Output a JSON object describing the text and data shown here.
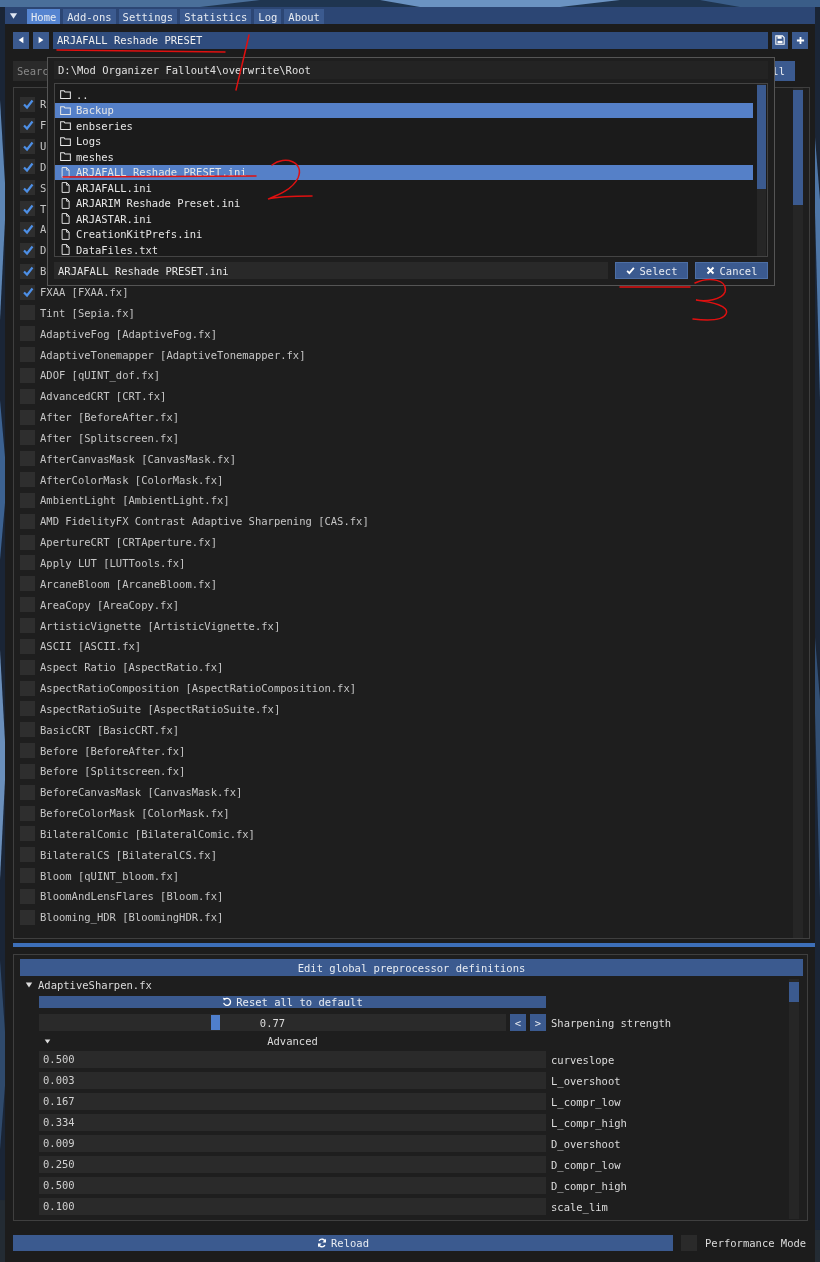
{
  "menu": {
    "tabs": [
      {
        "label": "Home",
        "selected": true
      },
      {
        "label": "Add-ons",
        "selected": false
      },
      {
        "label": "Settings",
        "selected": false
      },
      {
        "label": "Statistics",
        "selected": false
      },
      {
        "label": "Log",
        "selected": false
      },
      {
        "label": "About",
        "selected": false
      }
    ]
  },
  "preset": {
    "value": "ARJAFALL Reshade PRESET"
  },
  "search": {
    "placeholder": "Searc",
    "button": "ll"
  },
  "effects": [
    {
      "label": "R",
      "checked": true
    },
    {
      "label": "F",
      "checked": true
    },
    {
      "label": "U",
      "checked": true
    },
    {
      "label": "D",
      "checked": true
    },
    {
      "label": "S",
      "checked": true
    },
    {
      "label": "T",
      "checked": true
    },
    {
      "label": "A",
      "checked": true
    },
    {
      "label": "D",
      "checked": true
    },
    {
      "label": "B",
      "checked": true
    },
    {
      "label": "FXAA [FXAA.fx]",
      "checked": true
    },
    {
      "label": "Tint [Sepia.fx]",
      "checked": false
    },
    {
      "label": "AdaptiveFog [AdaptiveFog.fx]",
      "checked": false
    },
    {
      "label": "AdaptiveTonemapper [AdaptiveTonemapper.fx]",
      "checked": false
    },
    {
      "label": "ADOF [qUINT_dof.fx]",
      "checked": false
    },
    {
      "label": "AdvancedCRT [CRT.fx]",
      "checked": false
    },
    {
      "label": "After [BeforeAfter.fx]",
      "checked": false
    },
    {
      "label": "After [Splitscreen.fx]",
      "checked": false
    },
    {
      "label": "AfterCanvasMask [CanvasMask.fx]",
      "checked": false
    },
    {
      "label": "AfterColorMask [ColorMask.fx]",
      "checked": false
    },
    {
      "label": "AmbientLight [AmbientLight.fx]",
      "checked": false
    },
    {
      "label": "AMD FidelityFX Contrast Adaptive Sharpening [CAS.fx]",
      "checked": false
    },
    {
      "label": "ApertureCRT [CRTAperture.fx]",
      "checked": false
    },
    {
      "label": "Apply LUT [LUTTools.fx]",
      "checked": false
    },
    {
      "label": "ArcaneBloom [ArcaneBloom.fx]",
      "checked": false
    },
    {
      "label": "AreaCopy [AreaCopy.fx]",
      "checked": false
    },
    {
      "label": "ArtisticVignette [ArtisticVignette.fx]",
      "checked": false
    },
    {
      "label": "ASCII [ASCII.fx]",
      "checked": false
    },
    {
      "label": "Aspect Ratio [AspectRatio.fx]",
      "checked": false
    },
    {
      "label": "AspectRatioComposition [AspectRatioComposition.fx]",
      "checked": false
    },
    {
      "label": "AspectRatioSuite [AspectRatioSuite.fx]",
      "checked": false
    },
    {
      "label": "BasicCRT [BasicCRT.fx]",
      "checked": false
    },
    {
      "label": "Before [BeforeAfter.fx]",
      "checked": false
    },
    {
      "label": "Before [Splitscreen.fx]",
      "checked": false
    },
    {
      "label": "BeforeCanvasMask [CanvasMask.fx]",
      "checked": false
    },
    {
      "label": "BeforeColorMask [ColorMask.fx]",
      "checked": false
    },
    {
      "label": "BilateralComic [BilateralComic.fx]",
      "checked": false
    },
    {
      "label": "BilateralCS [BilateralCS.fx]",
      "checked": false
    },
    {
      "label": "Bloom [qUINT_bloom.fx]",
      "checked": false
    },
    {
      "label": "BloomAndLensFlares [Bloom.fx]",
      "checked": false
    },
    {
      "label": "Blooming_HDR [BloomingHDR.fx]",
      "checked": false
    }
  ],
  "file_dialog": {
    "path": "D:\\Mod Organizer Fallout4\\overwrite\\Root",
    "entries": [
      {
        "kind": "folder",
        "name": "..",
        "selected": false
      },
      {
        "kind": "folder",
        "name": "Backup",
        "selected": true
      },
      {
        "kind": "folder",
        "name": "enbseries",
        "selected": false
      },
      {
        "kind": "folder",
        "name": "Logs",
        "selected": false
      },
      {
        "kind": "folder",
        "name": "meshes",
        "selected": false
      },
      {
        "kind": "file",
        "name": "ARJAFALL Reshade PRESET.ini",
        "selected": true
      },
      {
        "kind": "file",
        "name": "ARJAFALL.ini",
        "selected": false
      },
      {
        "kind": "file",
        "name": "ARJARIM Reshade Preset.ini",
        "selected": false
      },
      {
        "kind": "file",
        "name": "ARJASTAR.ini",
        "selected": false
      },
      {
        "kind": "file",
        "name": "CreationKitPrefs.ini",
        "selected": false
      },
      {
        "kind": "file",
        "name": "DataFiles.txt",
        "selected": false
      }
    ],
    "filename": "ARJAFALL Reshade PRESET.ini",
    "select": "Select",
    "cancel": "Cancel"
  },
  "preprocessor": {
    "header": "Edit global preprocessor definitions",
    "effect": {
      "label": "AdaptiveSharpen.fx",
      "expanded": true
    },
    "reset": "Reset all to default",
    "slider": {
      "value": "0.77",
      "level": 0.38,
      "label": "Sharpening strength",
      "dec": "<",
      "inc": ">"
    },
    "advanced": {
      "label": "Advanced",
      "expanded": true
    },
    "params": [
      {
        "value": "0.500",
        "name": "curveslope"
      },
      {
        "value": "0.003",
        "name": "L_overshoot"
      },
      {
        "value": "0.167",
        "name": "L_compr_low"
      },
      {
        "value": "0.334",
        "name": "L_compr_high"
      },
      {
        "value": "0.009",
        "name": "D_overshoot"
      },
      {
        "value": "0.250",
        "name": "D_compr_low"
      },
      {
        "value": "0.500",
        "name": "D_compr_high"
      },
      {
        "value": "0.100",
        "name": "scale_lim"
      }
    ]
  },
  "footer": {
    "reload": "Reload",
    "performance_mode": {
      "label": "Performance Mode",
      "checked": false
    }
  }
}
